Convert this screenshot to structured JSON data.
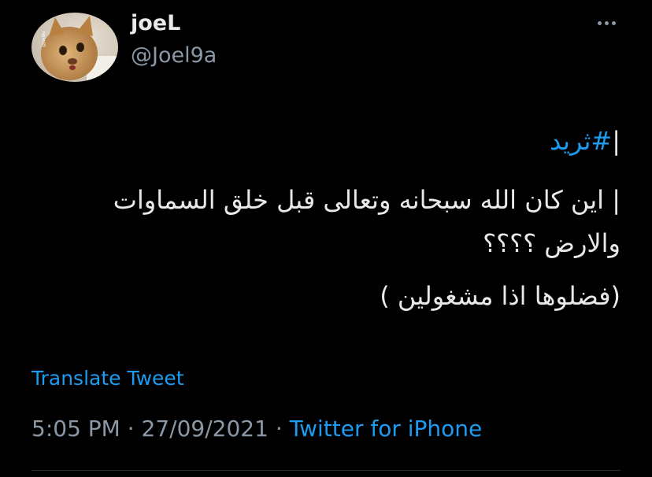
{
  "user": {
    "display_name": "joeL",
    "handle": "@Joel9a",
    "avatar_watermark": "@Joel9a"
  },
  "tweet": {
    "lines": [
      {
        "prefix": "|",
        "hashtag": "#ثريد"
      },
      {
        "text": "| اين كان الله سبحانه وتعالى قبل خلق السماوات والارض ؟؟؟؟"
      },
      {
        "text": "(فضلوها اذا مشغولين )"
      }
    ]
  },
  "translate_label": "Translate Tweet",
  "meta": {
    "time": "5:05 PM",
    "separator1": " · ",
    "date": "27/09/2021",
    "separator2": " · ",
    "source": "Twitter for iPhone"
  },
  "more_icon": "more-horizontal-icon",
  "colors": {
    "background": "#000000",
    "text": "#e7e9ea",
    "secondary": "#8b98a5",
    "link": "#1d9bf0"
  }
}
